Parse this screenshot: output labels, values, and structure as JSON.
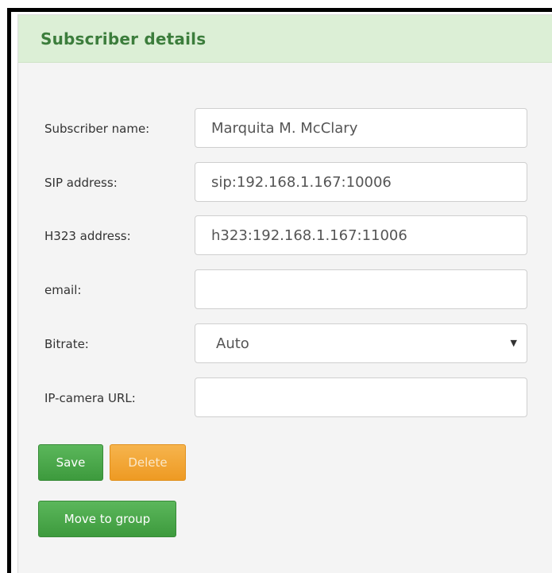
{
  "panel": {
    "title": "Subscriber details"
  },
  "form": {
    "subscriber_name": {
      "label": "Subscriber name:",
      "value": "Marquita M. McClary"
    },
    "sip_address": {
      "label": "SIP address:",
      "value": "sip:192.168.1.167:10006"
    },
    "h323_address": {
      "label": "H323 address:",
      "value": "h323:192.168.1.167:11006"
    },
    "email": {
      "label": "email:",
      "value": ""
    },
    "bitrate": {
      "label": "Bitrate:",
      "value": "Auto",
      "caret": "▼"
    },
    "ip_camera_url": {
      "label": "IP-camera URL:",
      "value": ""
    }
  },
  "buttons": {
    "save": "Save",
    "delete": "Delete",
    "move_to_group": "Move to group"
  },
  "colors": {
    "header_bg": "#dcefd6",
    "title": "#3c7d3c",
    "save_button": "#4caf50",
    "delete_button": "#f0a030"
  }
}
